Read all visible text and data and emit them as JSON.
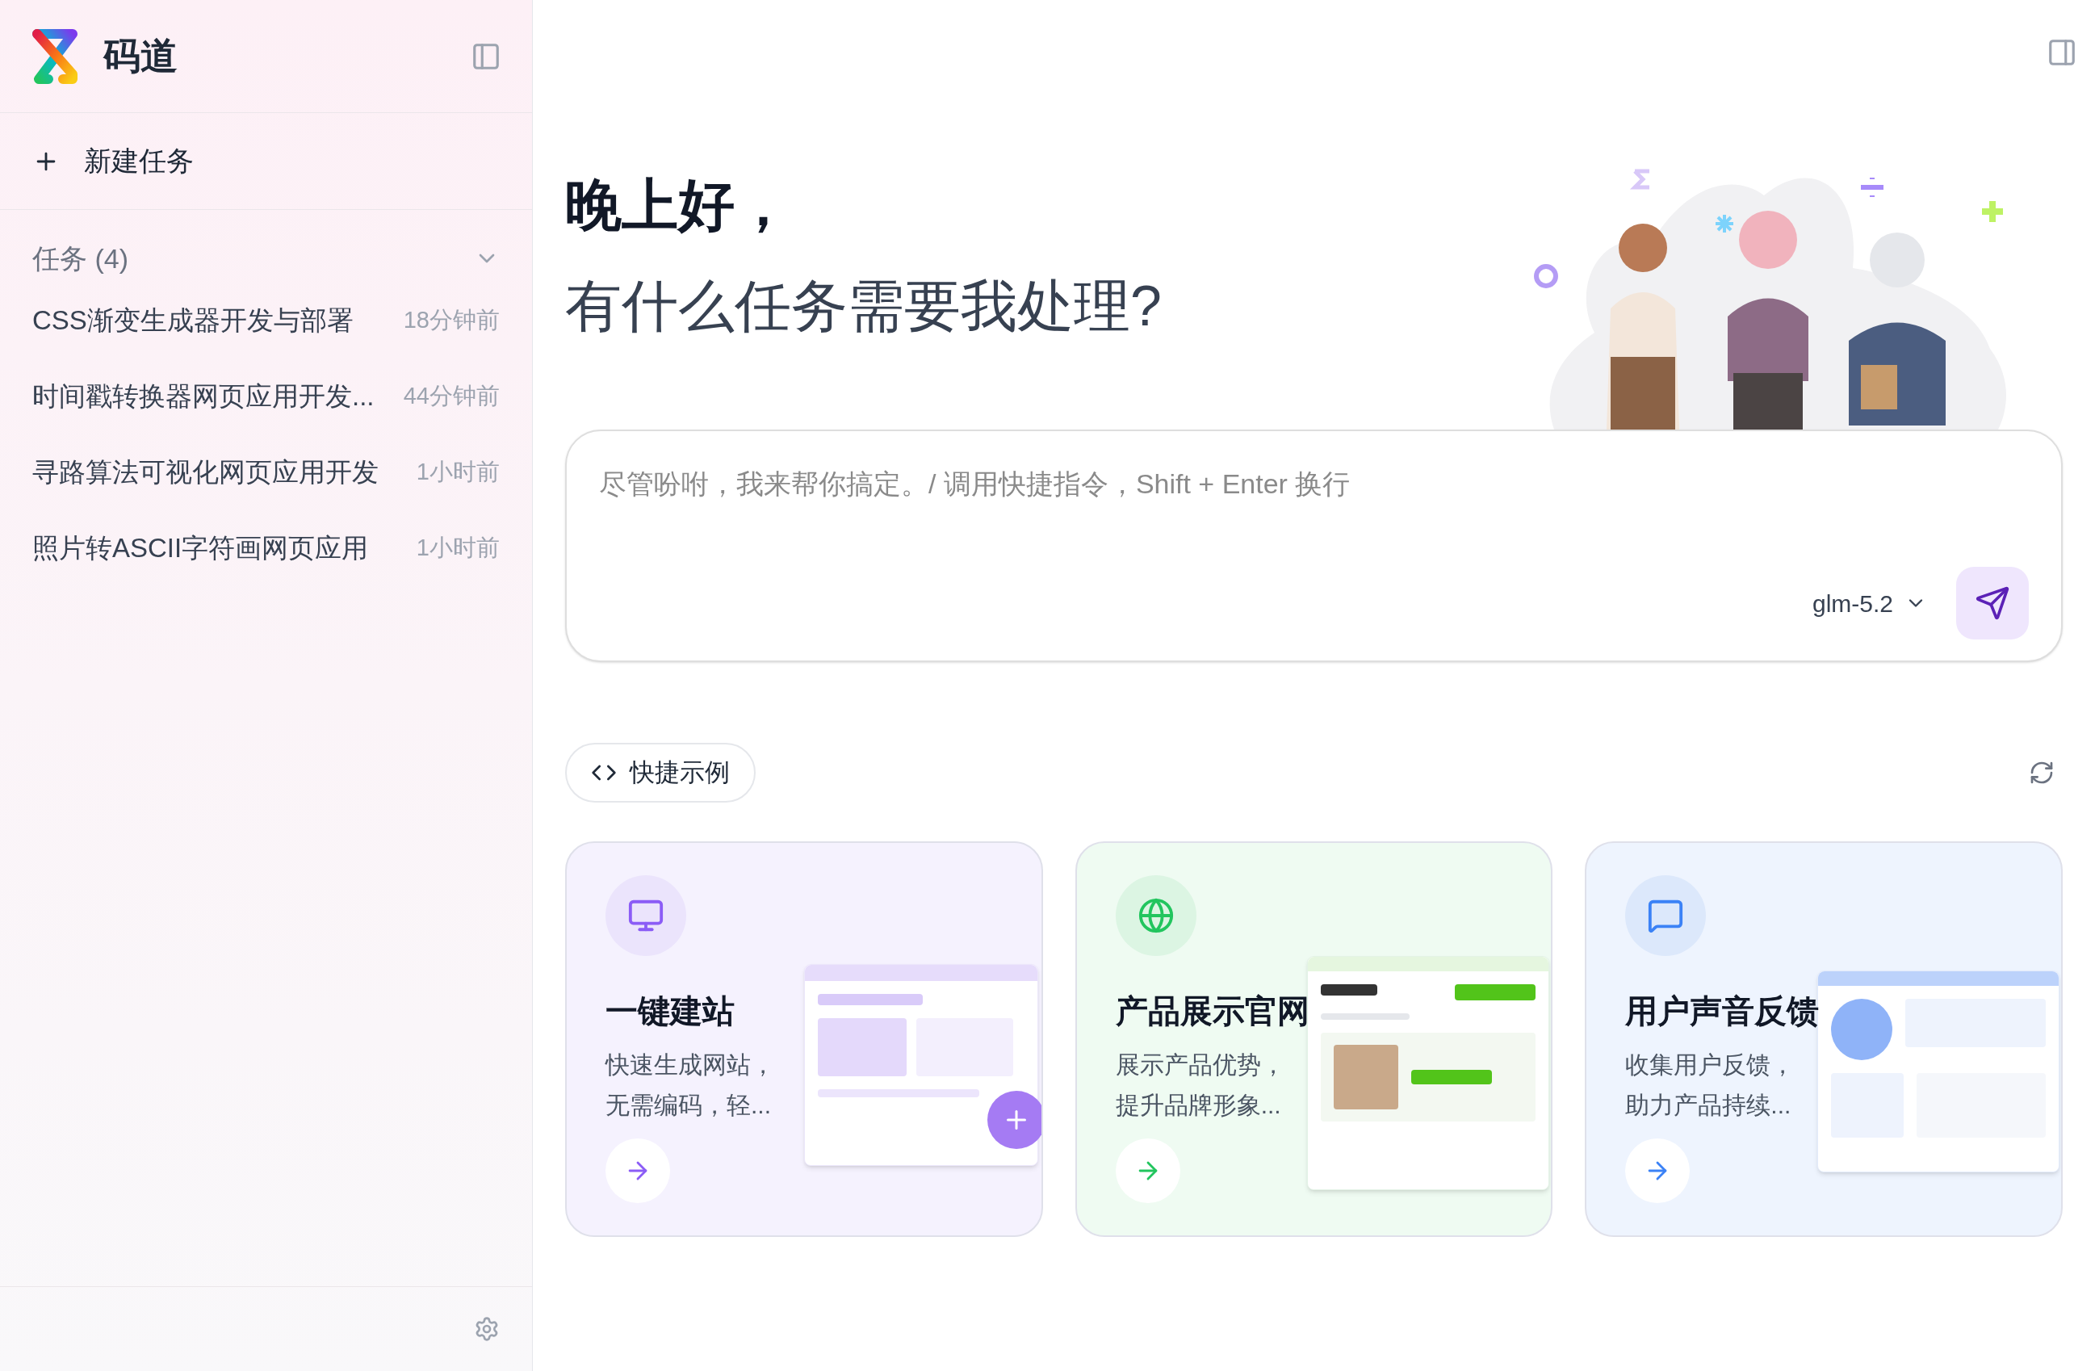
{
  "sidebar": {
    "app_name": "码道",
    "new_task": "新建任务",
    "tasks_header": "任务 (4)",
    "tasks_expanded": true,
    "tasks": [
      {
        "title": "CSS渐变生成器开发与部署",
        "time": "18分钟前",
        "selected": false
      },
      {
        "title": "时间戳转换器网页应用开发...",
        "time": "44分钟前",
        "selected": false
      },
      {
        "title": "寻路算法可视化网页应用开发",
        "time": "1小时前",
        "selected": false
      },
      {
        "title": "照片转ASCII字符画网页应用",
        "time": "1小时前",
        "selected": false
      }
    ]
  },
  "greeting": {
    "title": "晚上好，",
    "subtitle": "有什么任务需要我处理?"
  },
  "prompt": {
    "placeholder": "尽管吩咐，我来帮你搞定。/ 调用快捷指令，Shift + Enter 换行",
    "model": "glm-5.2"
  },
  "examples": {
    "label": "快捷示例",
    "cards": [
      {
        "kind": "website",
        "color": "#8b5cf6",
        "title": "一键建站",
        "description": "快速生成网站，无需编码，轻..."
      },
      {
        "kind": "product",
        "color": "#22c55e",
        "title": "产品展示官网",
        "description": "展示产品优势，提升品牌形象..."
      },
      {
        "kind": "feedback",
        "color": "#3b82f6",
        "title": "用户声音反馈",
        "description": "收集用户反馈，助力产品持续..."
      }
    ]
  }
}
